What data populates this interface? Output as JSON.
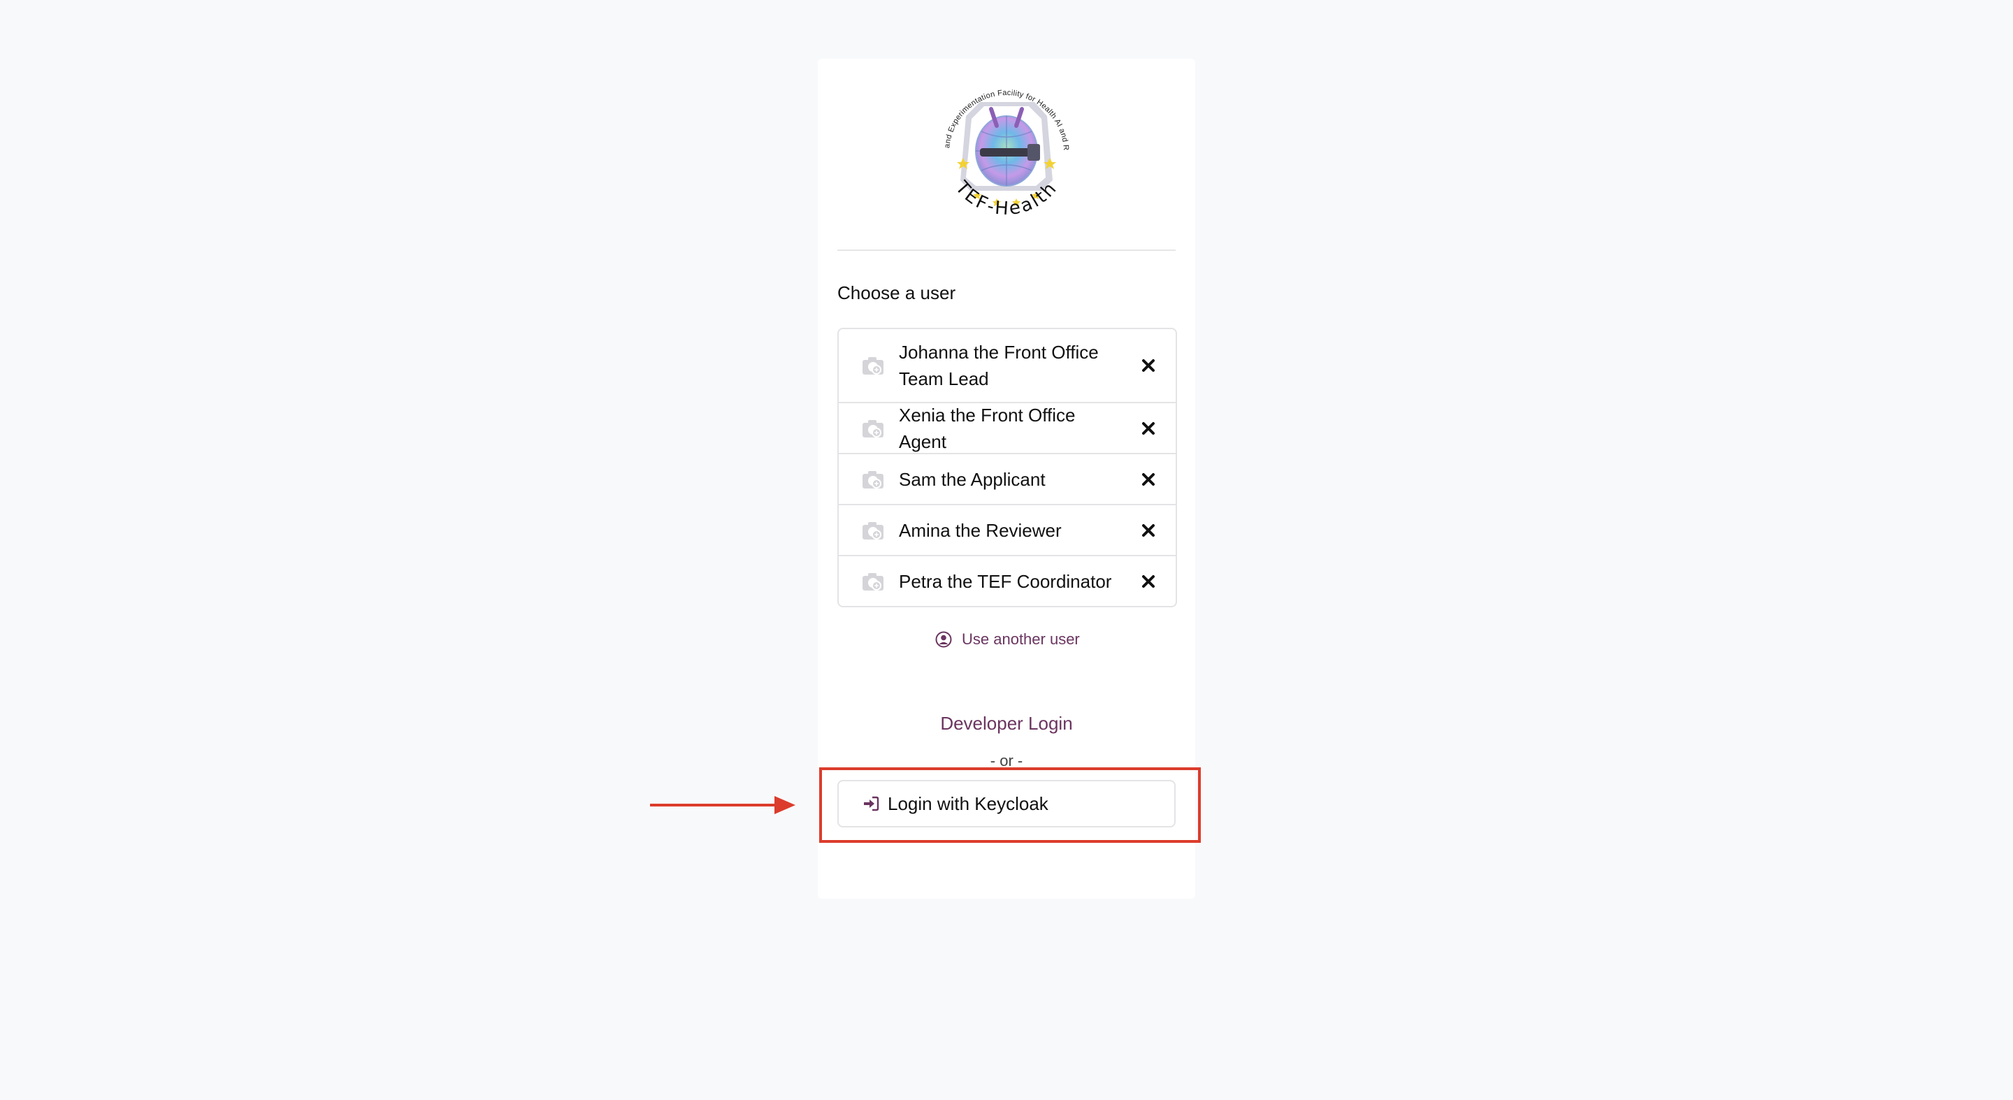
{
  "logo": {
    "ring_text": "Testing and Experimentation Facility for Health AI and Robotics",
    "brand_text": "TEF-Health",
    "icon": "tef-health-logo"
  },
  "chooser": {
    "title": "Choose a user",
    "users": [
      {
        "name": "Johanna the Front Office Team Lead",
        "avatar_icon": "camera-icon",
        "remove_icon": "close-icon"
      },
      {
        "name": "Xenia the Front Office Agent",
        "avatar_icon": "camera-icon",
        "remove_icon": "close-icon"
      },
      {
        "name": "Sam the Applicant",
        "avatar_icon": "camera-icon",
        "remove_icon": "close-icon"
      },
      {
        "name": "Amina the Reviewer",
        "avatar_icon": "camera-icon",
        "remove_icon": "close-icon"
      },
      {
        "name": "Petra the TEF Coordinator",
        "avatar_icon": "camera-icon",
        "remove_icon": "close-icon"
      }
    ],
    "another_user_label": "Use another user",
    "another_user_icon": "user-circle-icon"
  },
  "developer_login_label": "Developer Login",
  "or_label": "- or -",
  "keycloak_button": {
    "label": "Login with Keycloak",
    "icon": "sign-in-icon"
  },
  "annotation": {
    "highlight_color": "#dc3c2c",
    "arrow_color": "#dc3c2c"
  },
  "colors": {
    "accent": "#6b3560",
    "background": "#f8f9fb",
    "card": "#ffffff",
    "border": "#e4e4e7"
  }
}
